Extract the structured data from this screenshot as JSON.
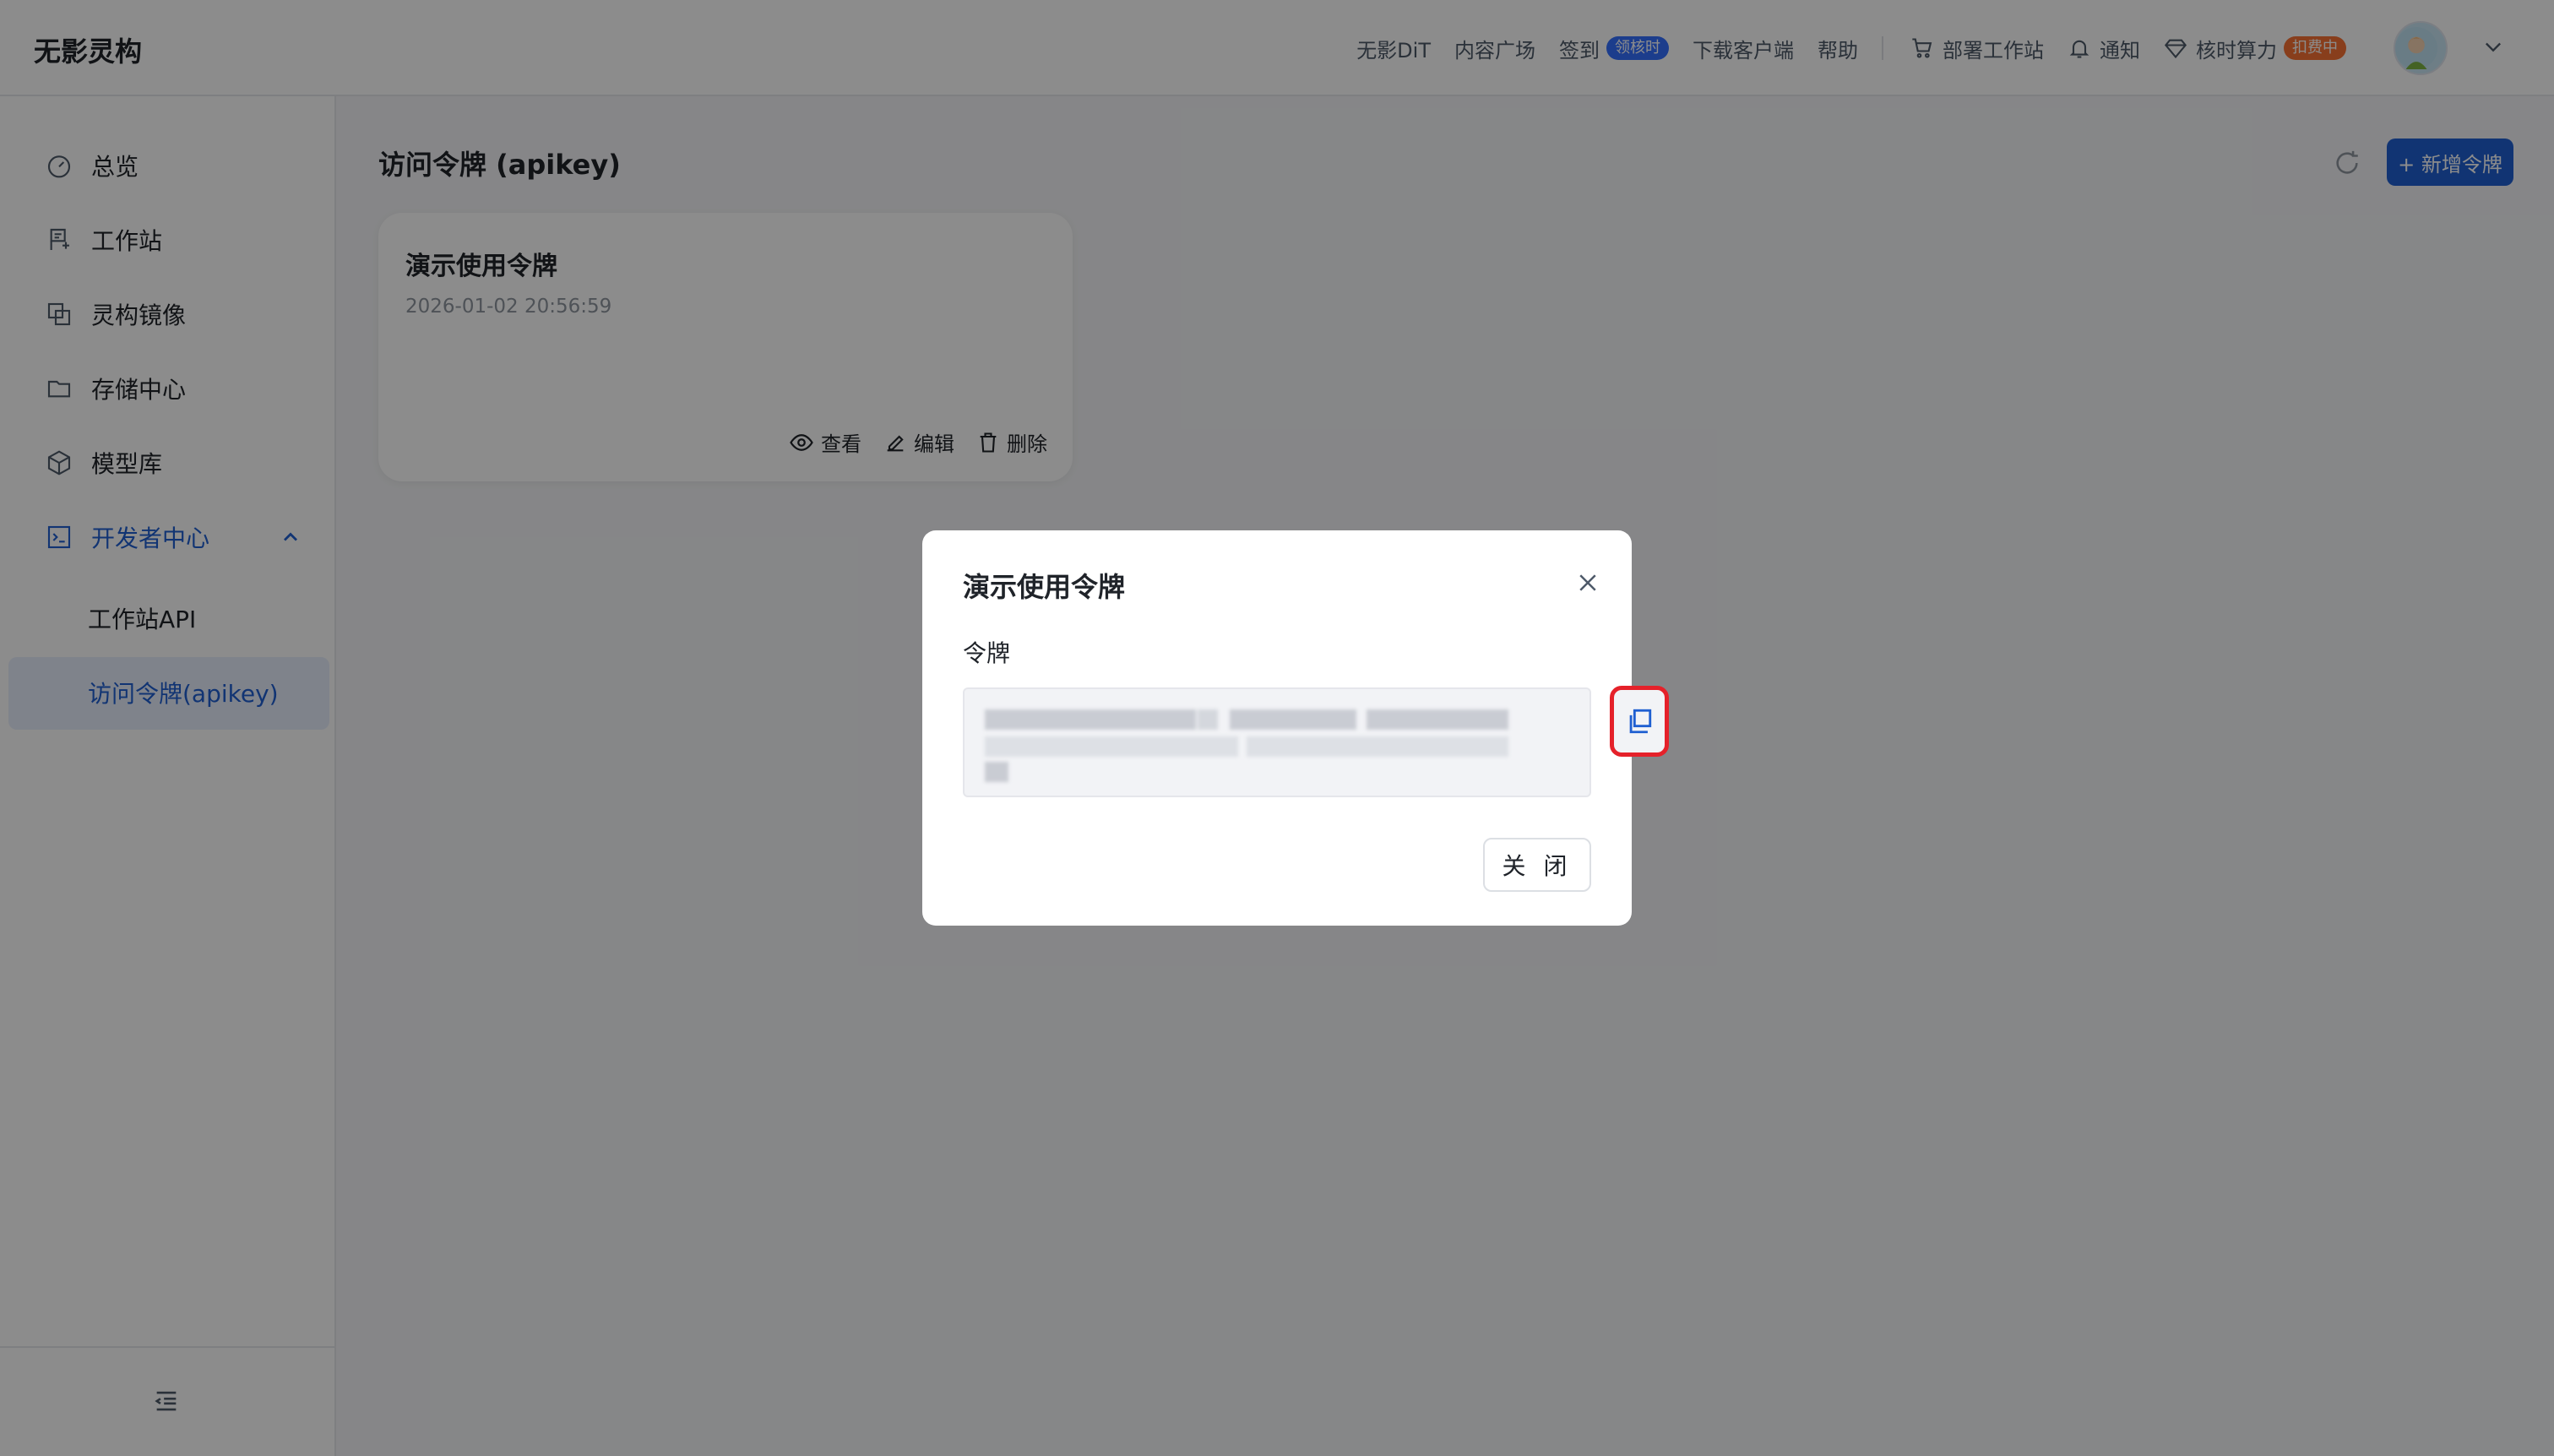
{
  "app": {
    "title": "无影灵构"
  },
  "topnav": {
    "items": [
      "无影DiT",
      "内容广场",
      "签到",
      "下载客户端",
      "帮助"
    ],
    "signin_badge": "领核时",
    "deploy": "部署工作站",
    "notify": "通知",
    "compute": "核时算力",
    "compute_badge": "扣费中"
  },
  "sidebar": {
    "items": [
      {
        "label": "总览",
        "icon": "dashboard-icon"
      },
      {
        "label": "工作站",
        "icon": "workstation-icon"
      },
      {
        "label": "灵构镜像",
        "icon": "image-icon"
      },
      {
        "label": "存储中心",
        "icon": "folder-icon"
      },
      {
        "label": "模型库",
        "icon": "model-icon"
      },
      {
        "label": "开发者中心",
        "icon": "terminal-icon"
      }
    ],
    "sub_items": [
      "工作站API",
      "访问令牌(apikey)"
    ]
  },
  "main": {
    "title": "访问令牌 (apikey)",
    "new_button": "+ 新增令牌"
  },
  "card": {
    "title": "演示使用令牌",
    "date": "2026-01-02 20:56:59",
    "actions": {
      "view": "查看",
      "edit": "编辑",
      "delete": "删除"
    }
  },
  "modal": {
    "title": "演示使用令牌",
    "field_label": "令牌",
    "close_button": "关 闭"
  },
  "colors": {
    "primary": "#1f5fd1",
    "highlight": "#e5212a",
    "badge_blue": "#3370ff",
    "badge_orange": "#f77234"
  }
}
